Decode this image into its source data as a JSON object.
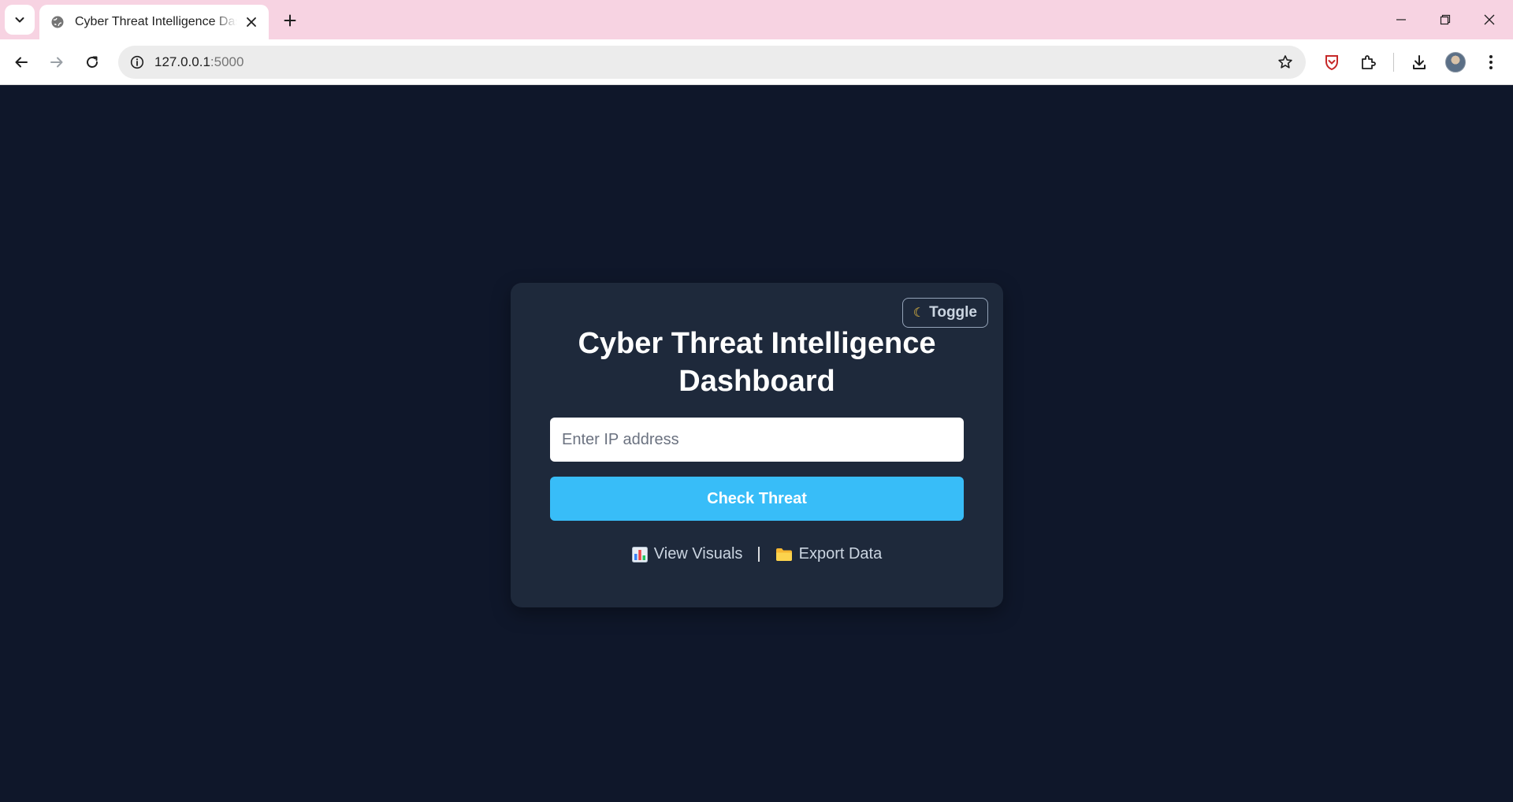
{
  "browser": {
    "tab_title": "Cyber Threat Intelligence Dashboard",
    "url_host": "127.0.0.1",
    "url_port": ":5000"
  },
  "card": {
    "toggle_label": "Toggle",
    "toggle_icon": "moon-icon",
    "title": "Cyber Threat Intelligence Dashboard",
    "ip_placeholder": "Enter IP address",
    "ip_value": "",
    "check_button": "Check Threat",
    "links": [
      {
        "icon": "bar-chart-icon",
        "label": "View Visuals"
      },
      {
        "icon": "folder-icon",
        "label": "Export Data"
      }
    ],
    "link_separator": "|"
  },
  "colors": {
    "page_bg": "#0f172a",
    "card_bg": "#1e293b",
    "accent": "#38bdf8",
    "chrome_title_bg": "#f7d3e2"
  }
}
